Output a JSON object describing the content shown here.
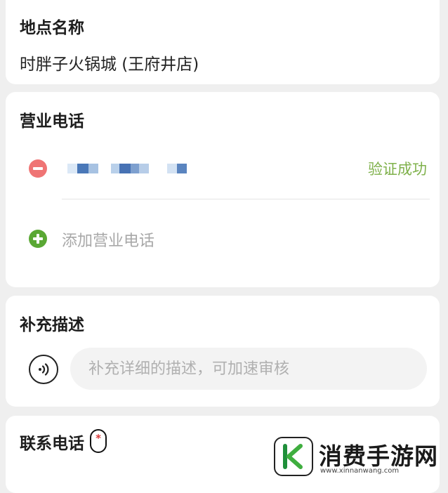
{
  "location": {
    "title": "地点名称",
    "value": "时胖子火锅城 (王府井店)"
  },
  "phone": {
    "title": "营业电话",
    "verify_status": "验证成功",
    "add_label": "添加营业电话",
    "colors": {
      "remove": "#ef7474",
      "add": "#5aa834",
      "verified": "#7fb14b"
    }
  },
  "description": {
    "title": "补充描述",
    "placeholder": "补充详细的描述，可加速审核",
    "voice_icon": "voice-wave-icon"
  },
  "contact": {
    "title": "联系电话",
    "required_mark": "*"
  },
  "watermark": {
    "text": "消费手游网",
    "url": "www.xinnanwang.com"
  }
}
